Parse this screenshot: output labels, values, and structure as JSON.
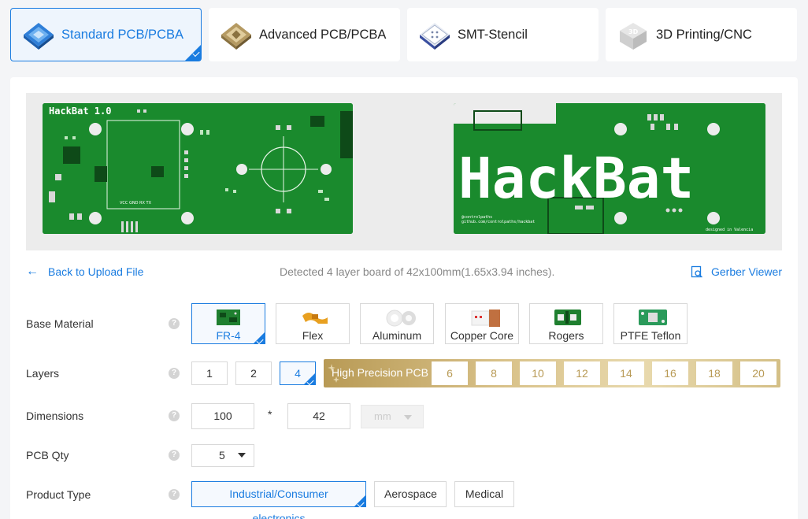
{
  "tabs": [
    {
      "label": "Standard PCB/PCBA",
      "icon": "standard-pcb-icon",
      "active": true
    },
    {
      "label": "Advanced PCB/PCBA",
      "icon": "advanced-pcb-icon",
      "active": false
    },
    {
      "label": "SMT-Stencil",
      "icon": "smt-stencil-icon",
      "active": false
    },
    {
      "label": "3D Printing/CNC",
      "icon": "3d-printing-icon",
      "active": false
    }
  ],
  "preview": {
    "front_title": "HackBat 1.0",
    "front_silk": "VCC GND RX TX",
    "back_title": "HackBat",
    "back_credit": "@controlpaths\ngithub.com/controlpaths/hackbat",
    "back_note": "designed in Valencia",
    "board_color": "#1a8a2d"
  },
  "info": {
    "back_label": "Back to Upload File",
    "detected": "Detected 4 layer board of 42x100mm(1.65x3.94 inches).",
    "gerber_label": "Gerber Viewer"
  },
  "base_material": {
    "label": "Base Material",
    "options": [
      "FR-4",
      "Flex",
      "Aluminum",
      "Copper Core",
      "Rogers",
      "PTFE Teflon"
    ],
    "selected": "FR-4"
  },
  "layers": {
    "label": "Layers",
    "options": [
      "1",
      "2",
      "4"
    ],
    "selected": "4",
    "high_precision_label": "High Precision PCB",
    "high_precision_options": [
      "6",
      "8",
      "10",
      "12",
      "14",
      "16",
      "18",
      "20"
    ]
  },
  "dimensions": {
    "label": "Dimensions",
    "width": "100",
    "separator": "*",
    "height": "42",
    "unit": "mm"
  },
  "pcb_qty": {
    "label": "PCB Qty",
    "value": "5"
  },
  "product_type": {
    "label": "Product Type",
    "options": [
      "Industrial/Consumer electronics",
      "Aerospace",
      "Medical"
    ],
    "selected": "Industrial/Consumer electronics"
  },
  "colors": {
    "accent": "#1a7ce0",
    "gold": "#b89a55"
  }
}
